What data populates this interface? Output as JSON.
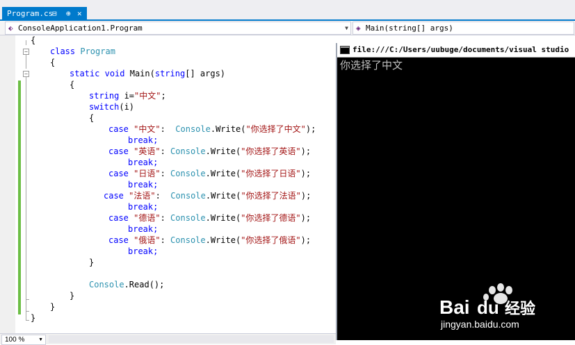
{
  "tab": {
    "name": "Program.cs",
    "pin_glyph": "⊕",
    "close_glyph": "✕",
    "lock_glyph": "⊟"
  },
  "navbar": {
    "left": {
      "icon": "class-icon",
      "text": "ConsoleApplication1.Program"
    },
    "right": {
      "icon": "method-icon",
      "text": "Main(string[] args)"
    }
  },
  "code": {
    "l01": "{",
    "l02_kw": "class",
    "l02_ty": "Program",
    "l03": "{",
    "l04_kw1": "static",
    "l04_kw2": "void",
    "l04_name": "Main(",
    "l04_kw3": "string",
    "l04_rest": "[] args)",
    "l05": "{",
    "l06_kw": "string",
    "l06_mid": " i=",
    "l06_str": "\"中文\"",
    "l06_end": ";",
    "l07_kw": "switch",
    "l07_rest": "(i)",
    "l08": "{",
    "c1_kw": "case",
    "c1_str": "\"中文\"",
    "c1_mid": ":  ",
    "c1_ty": "Console",
    "c1_call": ".Write(",
    "c1_arg": "\"你选择了中文\"",
    "c1_end": ");",
    "c2_kw": "case",
    "c2_str": "\"英语\"",
    "c2_mid": ": ",
    "c2_ty": "Console",
    "c2_call": ".Write(",
    "c2_arg": "\"你选择了英语\"",
    "c2_end": ");",
    "c3_kw": "case",
    "c3_str": "\"日语\"",
    "c3_mid": ": ",
    "c3_ty": "Console",
    "c3_call": ".Write(",
    "c3_arg": "\"你选择了日语\"",
    "c3_end": ");",
    "c4_kw": "case",
    "c4_str": "\"法语\"",
    "c4_mid": ":  ",
    "c4_ty": "Console",
    "c4_call": ".Write(",
    "c4_arg": "\"你选择了法语\"",
    "c4_end": ");",
    "c5_kw": "case",
    "c5_str": "\"德语\"",
    "c5_mid": ": ",
    "c5_ty": "Console",
    "c5_call": ".Write(",
    "c5_arg": "\"你选择了德语\"",
    "c5_end": ");",
    "c6_kw": "case",
    "c6_str": "\"俄语\"",
    "c6_mid": ": ",
    "c6_ty": "Console",
    "c6_call": ".Write(",
    "c6_arg": "\"你选择了俄语\"",
    "c6_end": ");",
    "brk": "break;",
    "l21": "}",
    "l23_ty": "Console",
    "l23_rest": ".Read();",
    "l24": "}",
    "l25": "}",
    "l26": "}"
  },
  "console": {
    "title": "file:///C:/Users/uubuge/documents/visual studio",
    "output": "你选择了中文"
  },
  "status": {
    "zoom": "100 %"
  },
  "watermark": {
    "brand": "Bai",
    "brand2": "du",
    "cn": "经验",
    "url": "jingyan.baidu.com"
  },
  "colors": {
    "accent": "#007acc",
    "keyword": "#0000ff",
    "type": "#2b91af",
    "string": "#a31515",
    "changebar": "#6cbe45"
  }
}
